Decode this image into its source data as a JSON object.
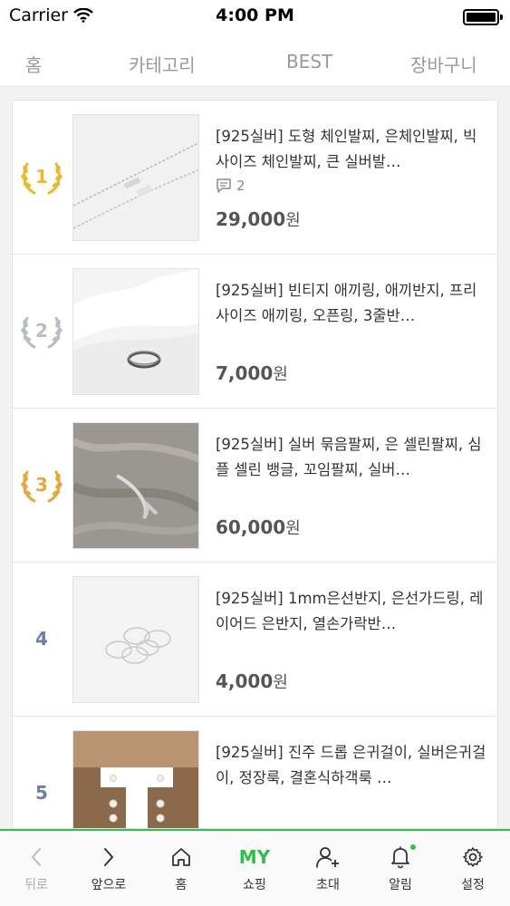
{
  "status_bar": {
    "carrier": "Carrier",
    "time": "4:00 PM"
  },
  "top_tabs": [
    {
      "label": "홈"
    },
    {
      "label": "카테고리"
    },
    {
      "label": "BEST"
    },
    {
      "label": "장바구니"
    }
  ],
  "items": [
    {
      "rank": "1",
      "rank_style": "gold",
      "title": "[925실버] 도형 체인발찌, 은체인발찌, 빅사이즈 체인발찌, 큰 실버발…",
      "comment_count": "2",
      "price": "29,000",
      "unit": "원"
    },
    {
      "rank": "2",
      "rank_style": "silver",
      "title": "[925실버] 빈티지 애끼링, 애끼반지, 프리사이즈 애끼링, 오픈링, 3줄반…",
      "comment_count": "",
      "price": "7,000",
      "unit": "원"
    },
    {
      "rank": "3",
      "rank_style": "bronze",
      "title": "[925실버] 실버 묶음팔찌, 은 셀린팔찌, 심플 셀린 뱅글, 꼬임팔찌, 실버…",
      "comment_count": "",
      "price": "60,000",
      "unit": "원"
    },
    {
      "rank": "4",
      "rank_style": "plain",
      "title": "[925실버] 1mm은선반지, 은선가드링, 레이어드 은반지, 열손가락반…",
      "comment_count": "",
      "price": "4,000",
      "unit": "원"
    },
    {
      "rank": "5",
      "rank_style": "plain",
      "title": "[925실버] 진주 드롭 은귀걸이, 실버은귀걸이, 정장룩, 결혼식하객룩 …",
      "comment_count": "",
      "price": "",
      "unit": ""
    }
  ],
  "bottom_nav": {
    "back": "뒤로",
    "forward": "앞으로",
    "home": "홈",
    "my_icon_text": "MY",
    "shopping": "쇼핑",
    "invite": "초대",
    "notifications": "알림",
    "settings": "설정"
  },
  "colors": {
    "accent": "#2fbf4a",
    "gold": "#e9b92a",
    "silver": "#b8bcc4",
    "bronze": "#e6a83a",
    "plain_rank": "#6b7fa8"
  },
  "icons": [
    "wifi-icon",
    "battery-icon",
    "laurel-icon",
    "comment-icon",
    "chevron-left-icon",
    "chevron-right-icon",
    "home-icon",
    "add-user-icon",
    "bell-icon",
    "gear-icon"
  ]
}
